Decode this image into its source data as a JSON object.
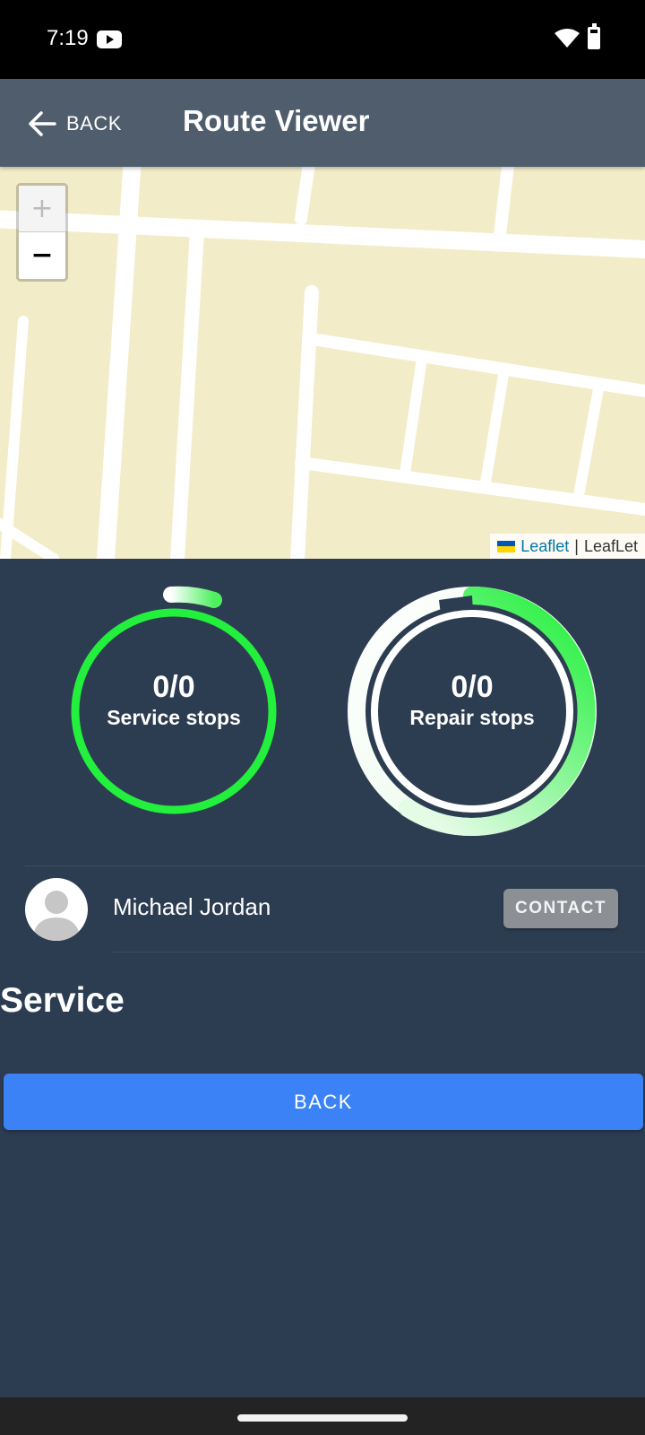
{
  "status_bar": {
    "time": "7:19",
    "icons": [
      "youtube-icon",
      "wifi-icon",
      "battery-icon"
    ]
  },
  "toolbar": {
    "back_label": "BACK",
    "back_icon": "arrow-left-icon",
    "title": "Route Viewer"
  },
  "map": {
    "zoom_in_label": "+",
    "zoom_out_label": "−",
    "attribution_link": "Leaflet",
    "attribution_separator": "|",
    "attribution_text": "LeafLet"
  },
  "stats": {
    "service": {
      "count": "0/0",
      "label": "Service stops",
      "color": "#22f03c"
    },
    "repair": {
      "count": "0/0",
      "label": "Repair stops",
      "color": "#22f03c"
    }
  },
  "driver": {
    "name": "Michael Jordan",
    "contact_label": "CONTACT"
  },
  "section_title": "Service",
  "back_button_label": "BACK",
  "colors": {
    "background": "#2d3d51",
    "toolbar": "#4f5d6d",
    "accent_green": "#22f03c",
    "primary_blue": "#3b82f6",
    "map_land": "#f3ecc8"
  }
}
